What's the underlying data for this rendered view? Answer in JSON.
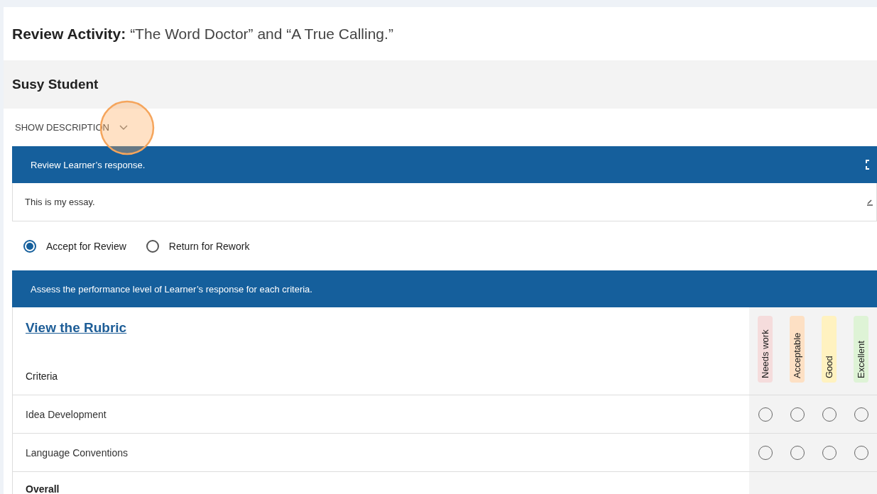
{
  "title": {
    "label": "Review Activity:",
    "text": "“The Word Doctor” and “A True Calling.”"
  },
  "student": {
    "name": "Susy Student"
  },
  "description_toggle": {
    "label": "SHOW DESCRIPTION",
    "expanded": false
  },
  "response_panel": {
    "heading": "Review Learner’s response.",
    "text": "This is my essay."
  },
  "review_options": [
    {
      "label": "Accept for Review",
      "selected": true
    },
    {
      "label": "Return for Rework",
      "selected": false
    }
  ],
  "assessment": {
    "heading": "Assess the performance level of Learner’s response for each criteria.",
    "rubric_link": "View the Rubric",
    "criteria_heading": "Criteria",
    "levels": [
      {
        "label": "Needs work",
        "color": "#f5dcdc"
      },
      {
        "label": "Acceptable",
        "color": "#fde0c4"
      },
      {
        "label": "Good",
        "color": "#fff2c0"
      },
      {
        "label": "Excellent",
        "color": "#def3d6"
      }
    ],
    "rows": [
      {
        "name": "Idea Development",
        "ratings": [
          {
            "selected": false
          },
          {
            "selected": false
          },
          {
            "selected": false
          },
          {
            "selected": false
          }
        ]
      },
      {
        "name": "Language Conventions",
        "ratings": [
          {
            "selected": false
          },
          {
            "selected": false
          },
          {
            "selected": false
          },
          {
            "selected": false
          }
        ]
      }
    ],
    "overall": "Overall"
  }
}
